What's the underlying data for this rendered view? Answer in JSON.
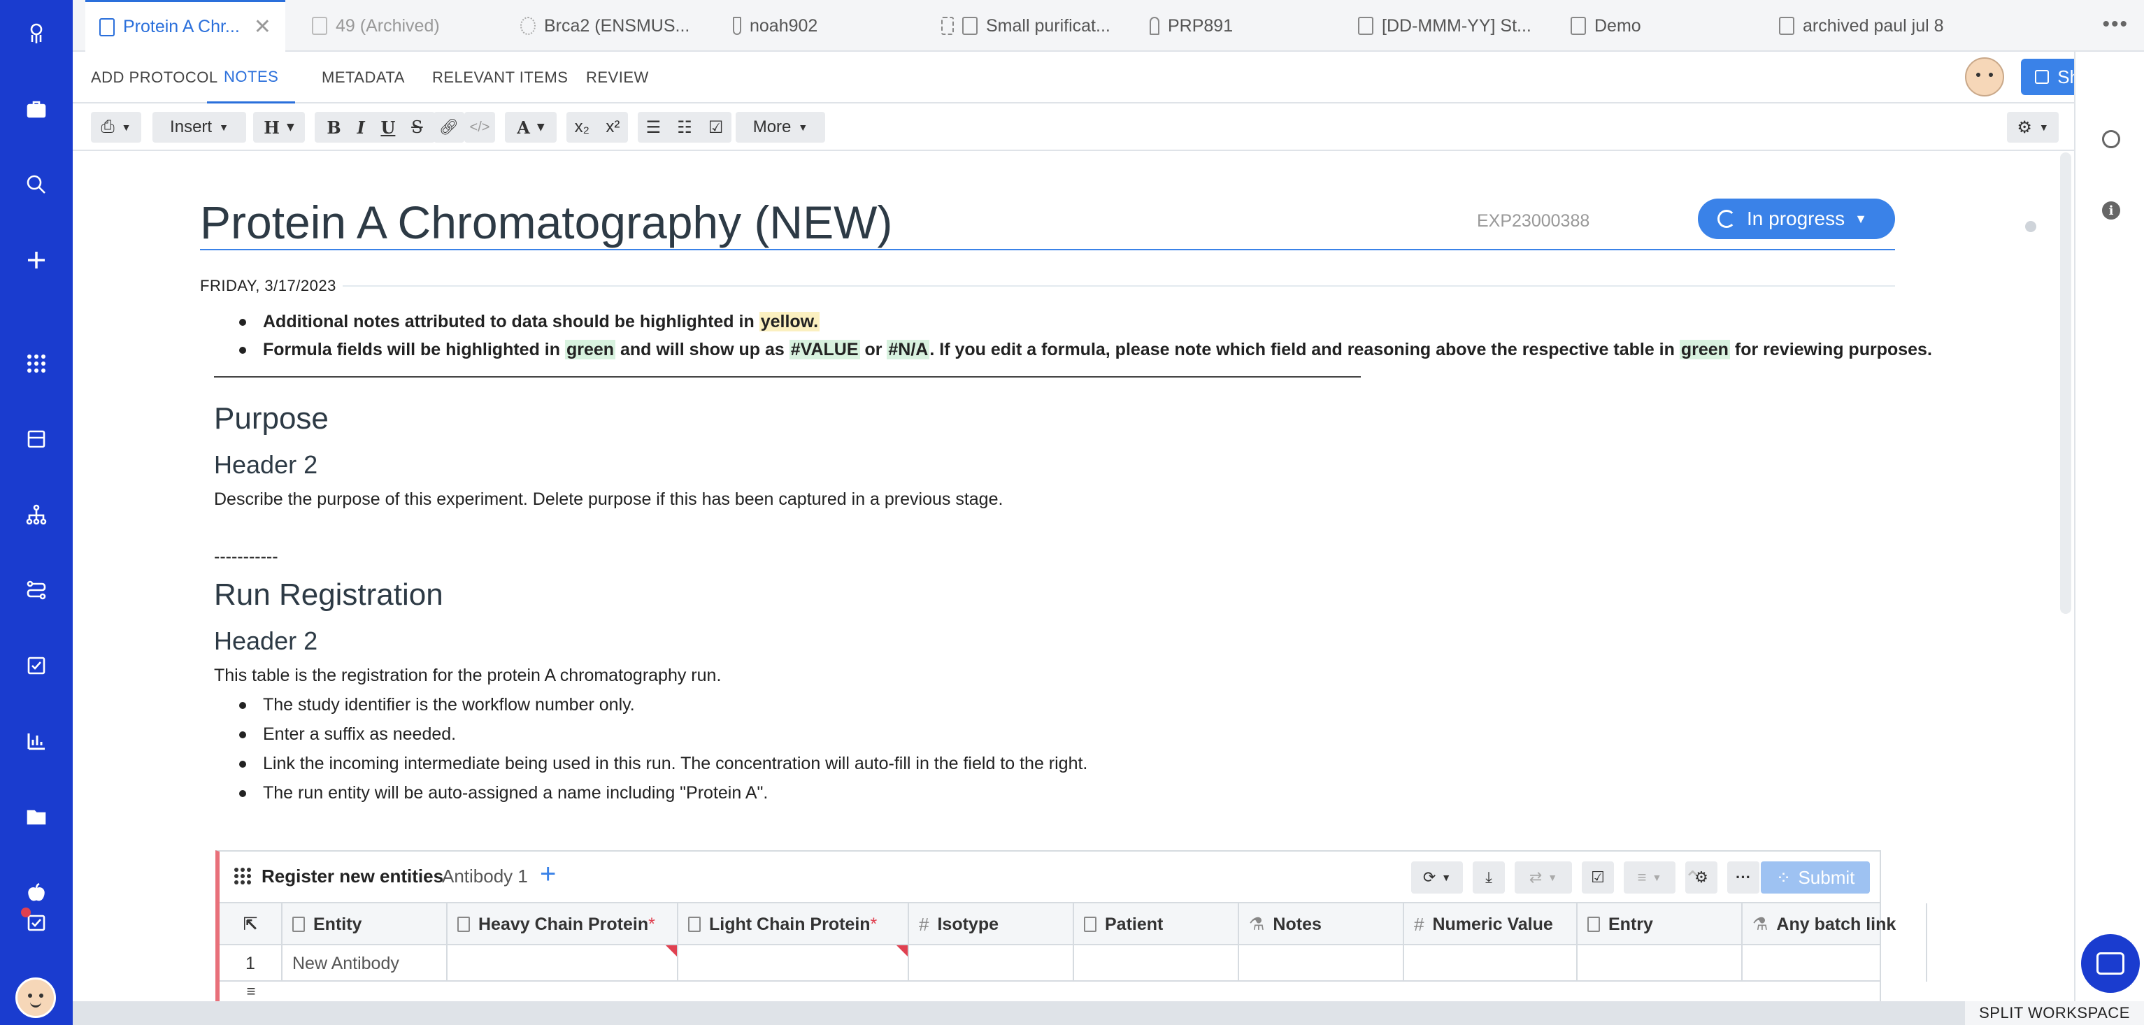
{
  "tabs": [
    {
      "label": "Protein A Chr...",
      "active": true
    },
    {
      "label": "49 (Archived)",
      "dim": true
    },
    {
      "label": "Brca2 (ENSMUS..."
    },
    {
      "label": "noah902"
    },
    {
      "label": "Small purificat..."
    },
    {
      "label": "PRP891"
    },
    {
      "label": "[DD-MMM-YY] St..."
    },
    {
      "label": "Demo"
    },
    {
      "label": "archived paul jul 8"
    }
  ],
  "tab_more": "•••",
  "subnav": [
    "ADD PROTOCOL",
    "NOTES",
    "METADATA",
    "RELEVANT ITEMS",
    "REVIEW"
  ],
  "share_label": "Share",
  "toolbar": {
    "insert": "Insert",
    "heading": "H",
    "bold": "B",
    "italic": "I",
    "underline": "U",
    "strike": "S",
    "textcolor": "A",
    "sub": "x₂",
    "sup": "x²",
    "more": "More"
  },
  "doc": {
    "title": "Protein A Chromatography (NEW)",
    "exp_id": "EXP23000388",
    "status": "In progress",
    "date": "FRIDAY, 3/17/2023",
    "note1_a": "Additional notes attributed to data should be highlighted in ",
    "note1_hl": "yellow.",
    "note2_a": "Formula fields will be highlighted in ",
    "note2_hl1": "green",
    "note2_b": " and will show up as ",
    "note2_hl2": "#VALUE",
    "note2_c": " or ",
    "note2_hl3": "#N/A",
    "note2_d": ". If you edit a formula, please note which field and reasoning above the respective table in ",
    "note2_hl4": "green",
    "note2_e": " for reviewing purposes.",
    "purpose_h1": "Purpose",
    "purpose_h2": "Header 2",
    "purpose_text": "Describe the purpose of this experiment. Delete purpose if this has been captured in a previous stage.",
    "separator": "-----------",
    "run_h1": "Run Registration",
    "run_h2": "Header 2",
    "run_text": "This table is the registration for the protein A chromatography run.",
    "run_bullets": [
      "The study identifier is the workflow number only.",
      "Enter a suffix as needed.",
      "Link the incoming intermediate being used in this run. The concentration will auto-fill in the field to the right.",
      "The run entity will be auto-assigned a name including \"Protein A\"."
    ]
  },
  "entity_table": {
    "title": "Register new entities",
    "schema": "Antibody 1",
    "submit": "Submit",
    "columns": [
      "Entity",
      "Heavy Chain Protein",
      "Light Chain Protein",
      "Isotype",
      "Patient",
      "Notes",
      "Numeric Value",
      "Entry",
      "Any batch link"
    ],
    "required_mark": "*",
    "rows": [
      {
        "num": "1",
        "entity": "New Antibody"
      }
    ]
  },
  "split_workspace": "SPLIT WORKSPACE"
}
